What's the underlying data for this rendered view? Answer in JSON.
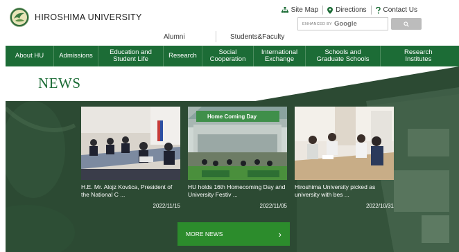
{
  "header": {
    "university_name": "HIROSHIMA UNIVERSITY",
    "utility_links": [
      {
        "label": "Site Map",
        "icon": "sitemap-icon"
      },
      {
        "label": "Directions",
        "icon": "map-pin-icon"
      },
      {
        "label": "Contact Us",
        "icon": "question-icon"
      }
    ],
    "search": {
      "enhanced_by": "ENHANCED BY",
      "provider": "Google",
      "button_icon": "search-icon"
    },
    "sub_links": {
      "alumni": "Alumni",
      "students_faculty": "Students&Faculty"
    }
  },
  "nav": [
    {
      "label": "About HU"
    },
    {
      "label": "Admissions"
    },
    {
      "label": "Education and\nStudent Life"
    },
    {
      "label": "Research"
    },
    {
      "label": "Social\nCooperation"
    },
    {
      "label": "International\nExchange"
    },
    {
      "label": "Schools and\nGraduate Schools"
    },
    {
      "label": "Research\nInstitutes"
    }
  ],
  "news": {
    "heading": "NEWS",
    "items": [
      {
        "title": "H.E. Mr. Alojz Kovšca, President of the National C ...",
        "date": "2022/11/15"
      },
      {
        "title": "HU holds 16th Homecoming Day and University Festiv ...",
        "date": "2022/11/05",
        "banner_text": "Home Coming Day"
      },
      {
        "title": "Hiroshima University picked as university with bes ...",
        "date": "2022/10/31"
      }
    ],
    "more_label": "MORE NEWS",
    "more_arrow": "›"
  },
  "colors": {
    "brand_green": "#1c6c36",
    "button_green": "#2c8c2c",
    "hero_dark": "#1f3e29"
  }
}
